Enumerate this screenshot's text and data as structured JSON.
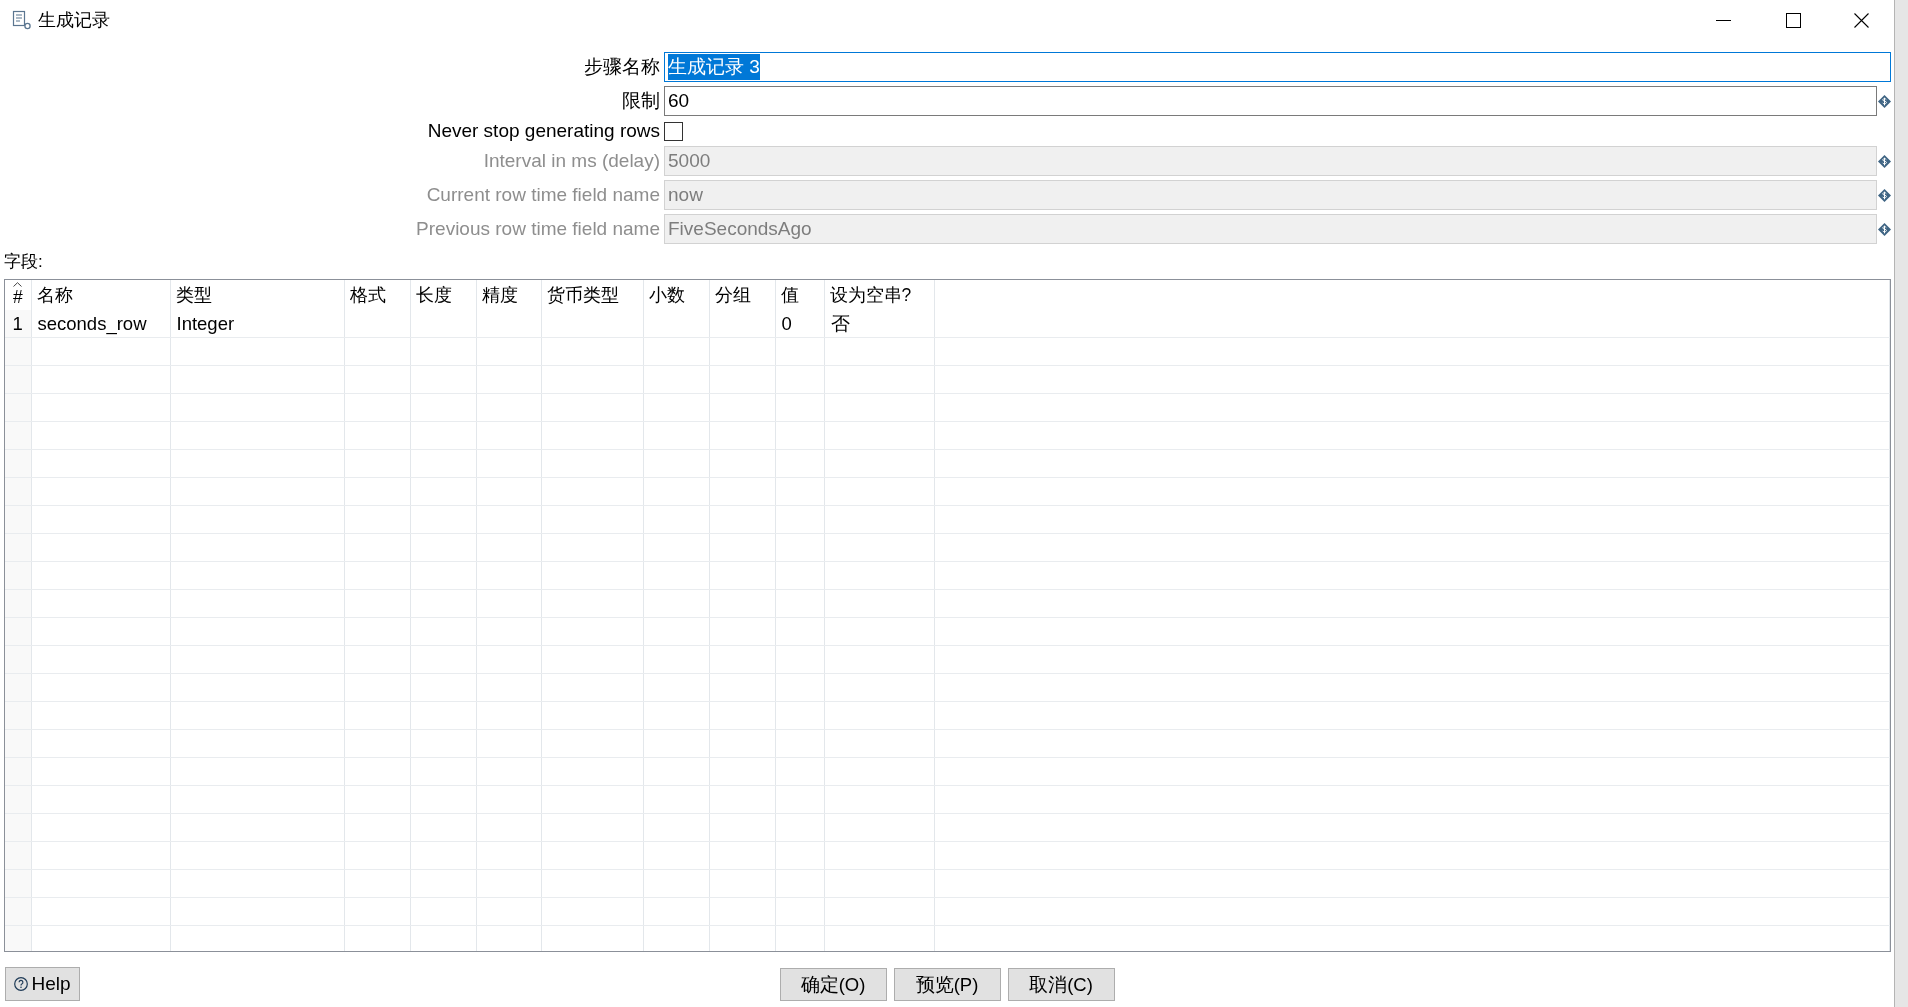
{
  "window": {
    "title": "生成记录"
  },
  "form": {
    "fields": [
      {
        "kind": "text",
        "label": "步骤名称",
        "value": "生成记录 3",
        "disabled": false,
        "focused": true,
        "variable": false
      },
      {
        "kind": "text",
        "label": "限制",
        "value": "60",
        "disabled": false,
        "focused": false,
        "variable": true
      },
      {
        "kind": "checkbox",
        "label": "Never stop generating rows",
        "disabled": false,
        "checked": false
      },
      {
        "kind": "text",
        "label": "Interval in ms (delay)",
        "value": "5000",
        "disabled": true,
        "focused": false,
        "variable": true
      },
      {
        "kind": "text",
        "label": "Current row time field name",
        "value": "now",
        "disabled": true,
        "focused": false,
        "variable": true
      },
      {
        "kind": "text",
        "label": "Previous row time field name",
        "value": "FiveSecondsAgo",
        "disabled": true,
        "focused": false,
        "variable": true
      }
    ]
  },
  "fields_table": {
    "label": "字段:",
    "columns": [
      {
        "label": "#",
        "sorted": true
      },
      {
        "label": "名称",
        "sorted": false
      },
      {
        "label": "类型",
        "sorted": false
      },
      {
        "label": "格式",
        "sorted": false
      },
      {
        "label": "长度",
        "sorted": false
      },
      {
        "label": "精度",
        "sorted": false
      },
      {
        "label": "货币类型",
        "sorted": false
      },
      {
        "label": "小数",
        "sorted": false
      },
      {
        "label": "分组",
        "sorted": false
      },
      {
        "label": "值",
        "sorted": false
      },
      {
        "label": "设为空串?",
        "sorted": false
      }
    ],
    "rows": [
      {
        "cells": [
          "1",
          "seconds_row",
          "Integer",
          null,
          null,
          null,
          null,
          null,
          null,
          "0",
          "否"
        ]
      }
    ]
  },
  "footer": {
    "help_button": {
      "label": "Help"
    },
    "buttons": [
      {
        "label": "确定(O)"
      },
      {
        "label": "预览(P)"
      },
      {
        "label": "取消(C)"
      }
    ]
  }
}
